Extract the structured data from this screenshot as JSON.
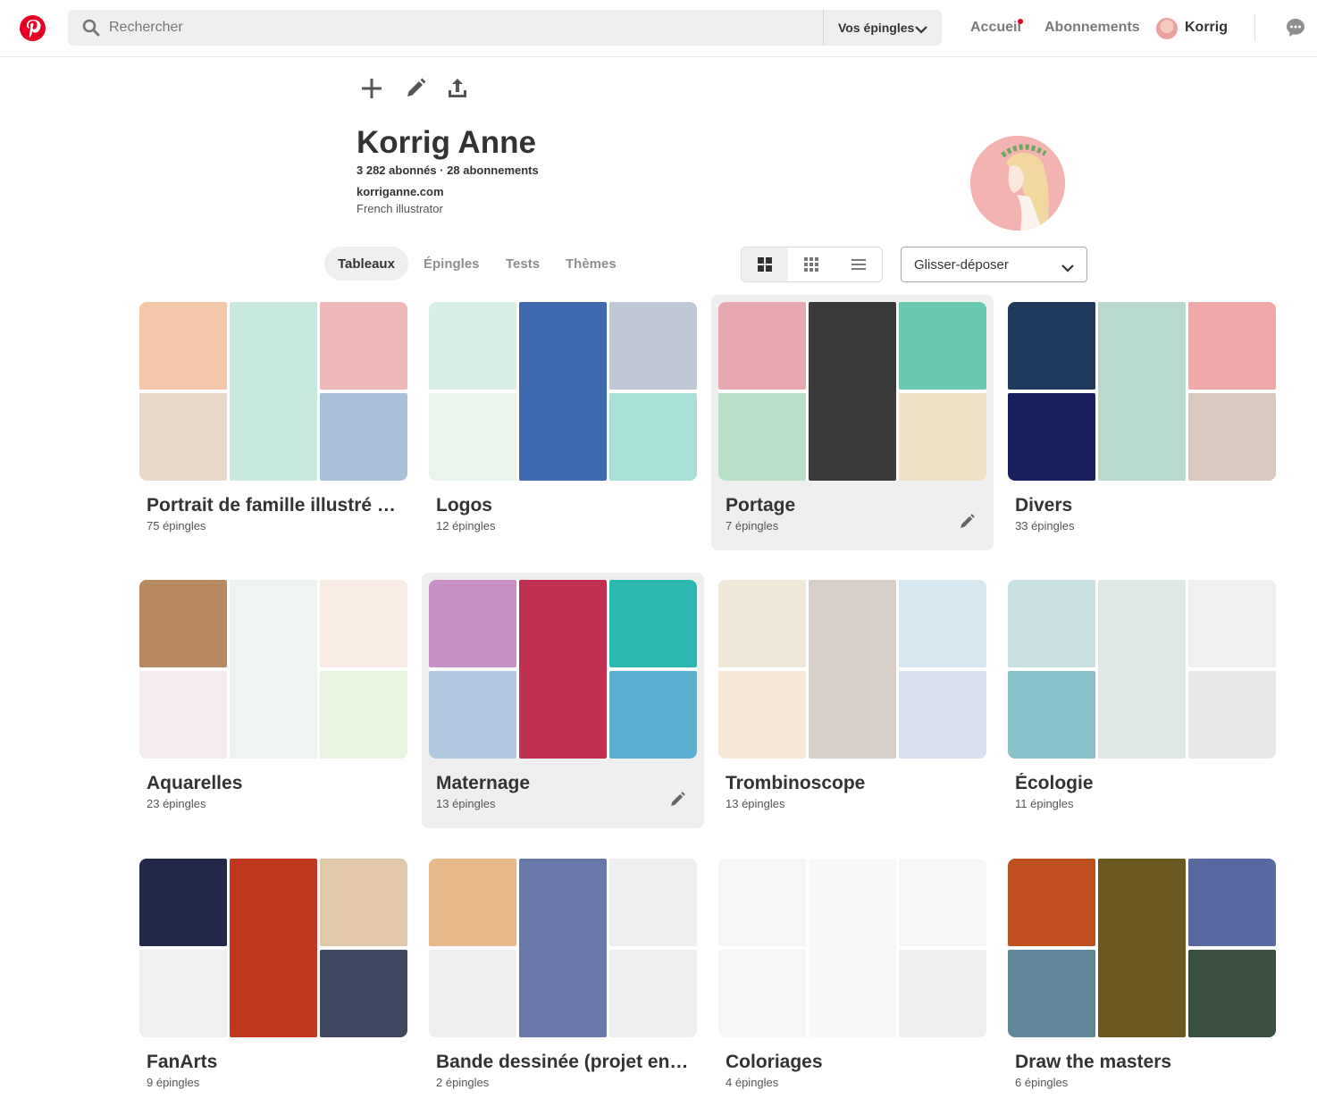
{
  "header": {
    "search_placeholder": "Rechercher",
    "search_scope": "Vos épingles",
    "nav_home": "Accueil",
    "nav_following": "Abonnements",
    "user_name": "Korrig"
  },
  "profile": {
    "name": "Korrig Anne",
    "stats": "3 282 abonnés · 28 abonnements",
    "website": "korriganne.com",
    "bio": "French illustrator"
  },
  "tabs": [
    "Tableaux",
    "Épingles",
    "Tests",
    "Thèmes"
  ],
  "sort": {
    "selected": "Glisser-déposer"
  },
  "boards": [
    {
      "title": "Portrait de famille illustré e...",
      "count": "75 épingles",
      "colors": [
        "#f4c7a8",
        "#e8d8c8",
        "#c8e8e0",
        "#f0b8b8",
        "#a8c0d8"
      ]
    },
    {
      "title": "Logos",
      "count": "12 épingles",
      "colors": [
        "#d8efe8",
        "#e8f4ec",
        "#3e6bb0",
        "#bfc8d4",
        "#a8e0d8"
      ]
    },
    {
      "title": "Portage",
      "count": "7 épingles",
      "colors": [
        "#e8a8b0",
        "#b8e0c8",
        "#3a3a3a",
        "#68c8b0",
        "#f0e0c8"
      ]
    },
    {
      "title": "Divers",
      "count": "33 épingles",
      "colors": [
        "#1f3a5c",
        "#1a1f5e",
        "#b8d8d0",
        "#f0a8a8",
        "#d8c8c0"
      ]
    },
    {
      "title": "Aquarelles",
      "count": "23 épingles",
      "colors": [
        "#b88860",
        "#f4ecec",
        "#f0f4f0",
        "#f8ece4",
        "#e8f4e0"
      ]
    },
    {
      "title": "Maternage",
      "count": "13 épingles",
      "colors": [
        "#c890c8",
        "#b0c8e0",
        "#c03050",
        "#2ab8b0",
        "#5ab0d0"
      ]
    },
    {
      "title": "Trombinoscope",
      "count": "13 épingles",
      "colors": [
        "#f0e8d8",
        "#f8e8d8",
        "#d8d0c8",
        "#d8e8f0",
        "#d8e0f0"
      ]
    },
    {
      "title": "Écologie",
      "count": "11 épingles",
      "colors": [
        "#c8e0e0",
        "#88c0c8",
        "#e0e8e8",
        "#f0f0f0",
        "#e8e8e8"
      ]
    },
    {
      "title": "FanArts",
      "count": "9 épingles",
      "colors": [
        "#22284a",
        "#f0f0f0",
        "#c03820",
        "#e0c8a8",
        "#404860"
      ]
    },
    {
      "title": "Bande dessinée (projet en c...",
      "count": "2 épingles",
      "colors": [
        "#e8b888",
        "#efefef",
        "#6878a8",
        "#efefef",
        "#efefef"
      ]
    },
    {
      "title": "Coloriages",
      "count": "4 épingles",
      "colors": [
        "#f6f6f6",
        "#f6f6f6",
        "#f8f8f8",
        "#f6f6f6",
        "#efefef"
      ]
    },
    {
      "title": "Draw the masters",
      "count": "6 épingles",
      "colors": [
        "#c05020",
        "#608898",
        "#6a5820",
        "#5868a0",
        "#3a5040"
      ]
    }
  ]
}
